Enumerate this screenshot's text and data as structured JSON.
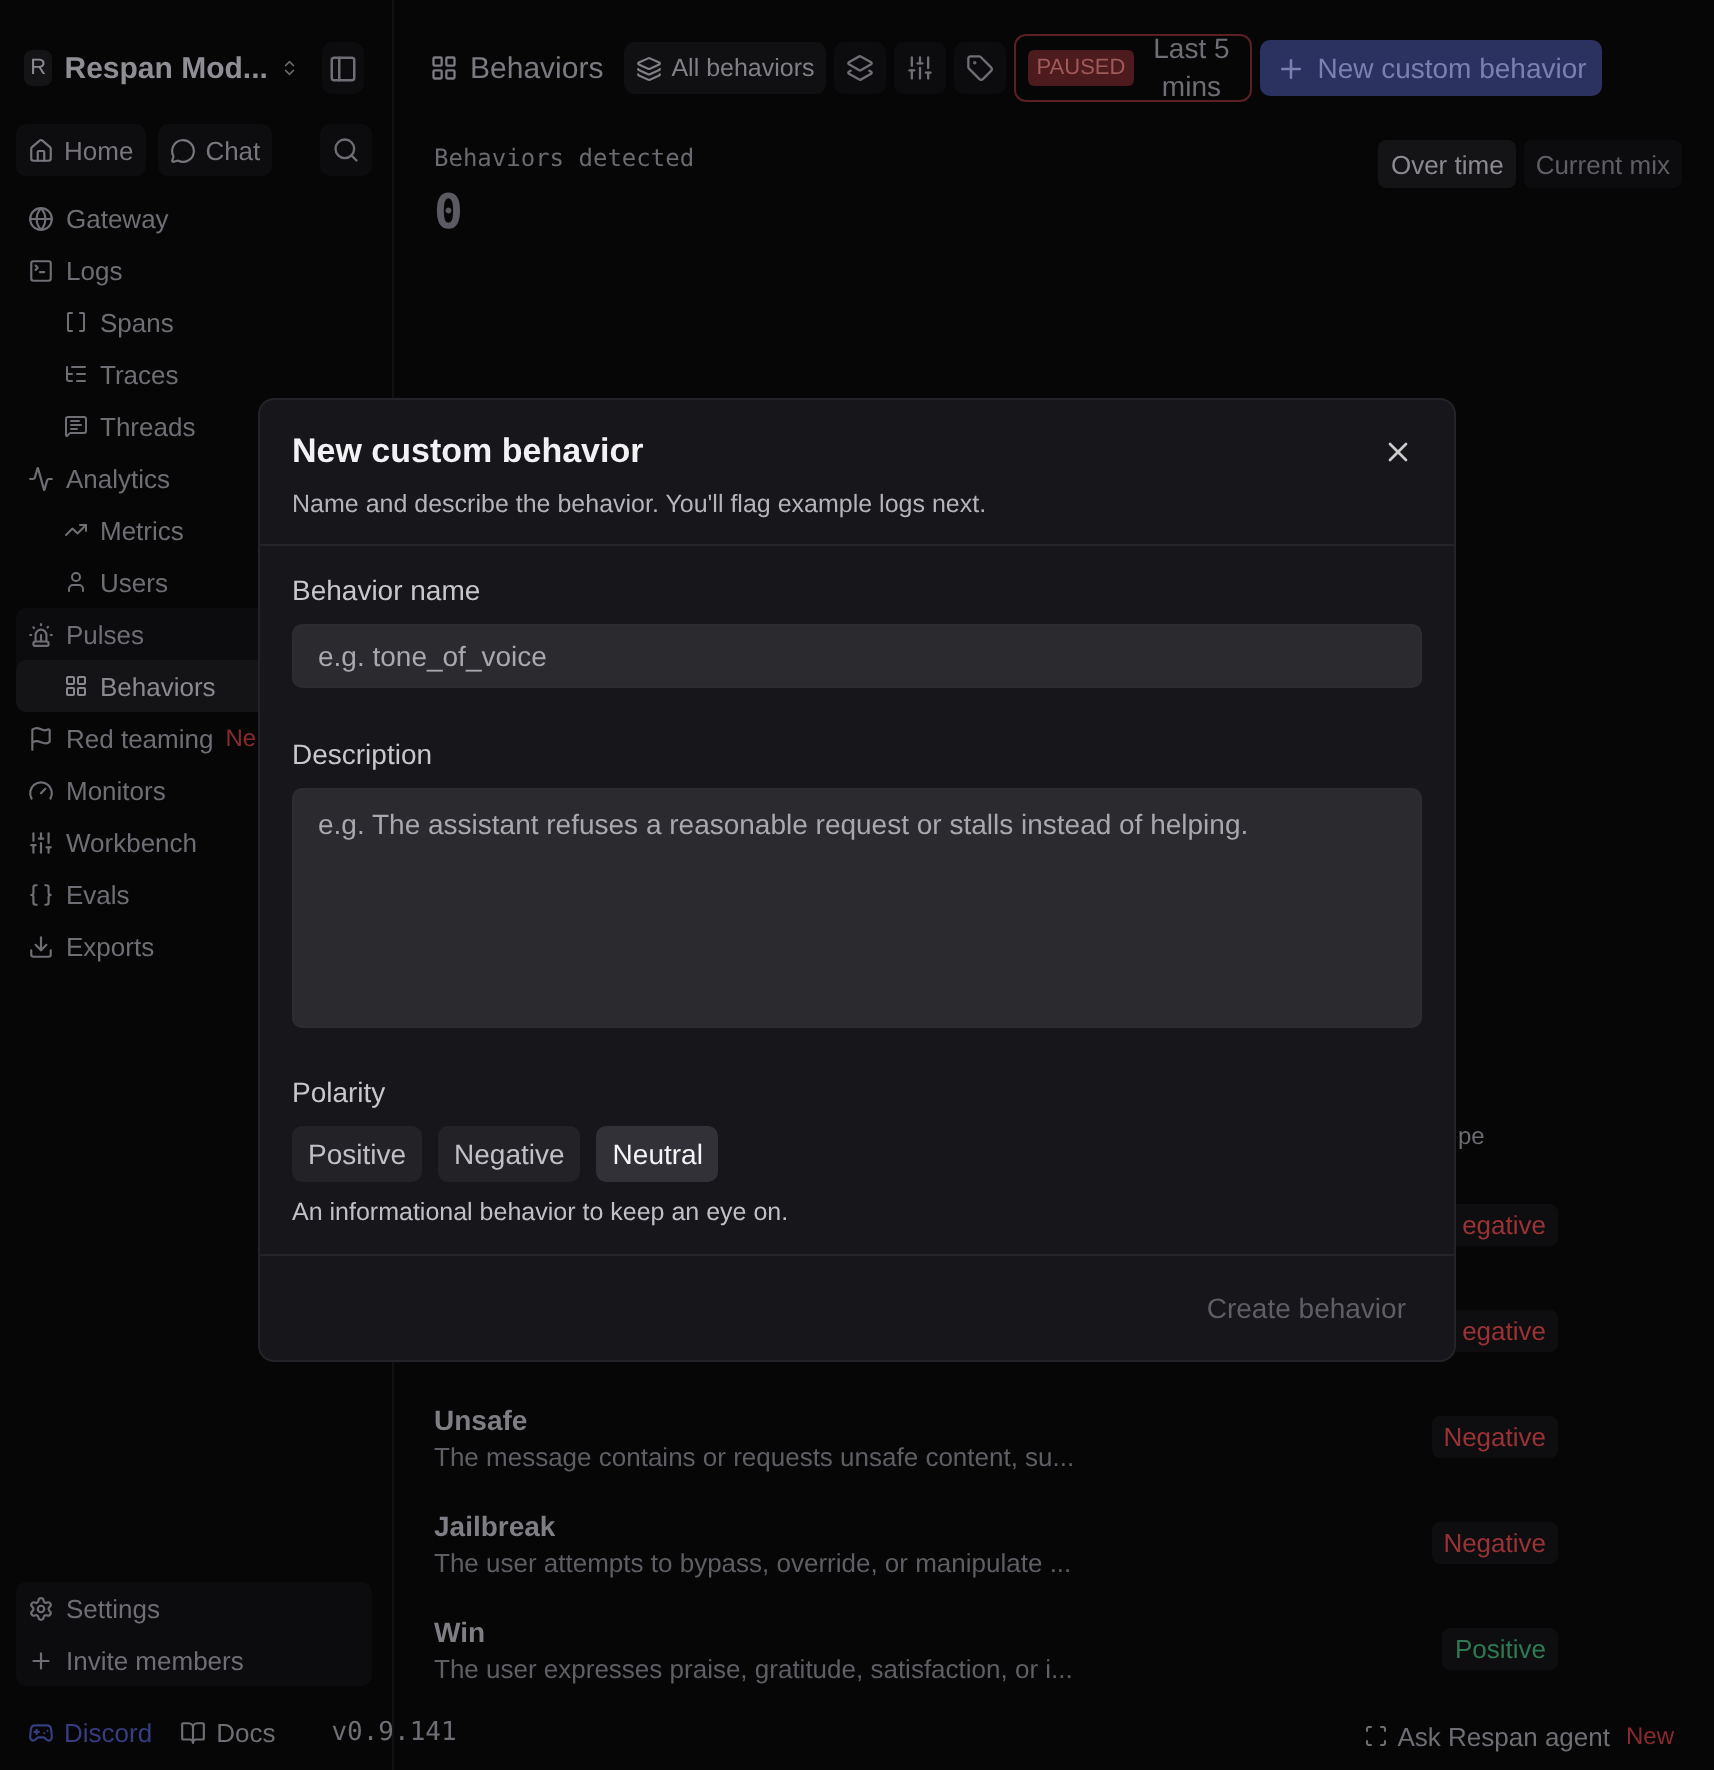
{
  "sidebar": {
    "workspace": {
      "initial": "R",
      "name": "Respan Mod..."
    },
    "quick": [
      {
        "label": "Home"
      },
      {
        "label": "Chat"
      }
    ],
    "nav": [
      {
        "label": "Gateway"
      },
      {
        "label": "Logs",
        "children": [
          {
            "label": "Spans",
            "selected": false
          },
          {
            "label": "Traces",
            "selected": false
          },
          {
            "label": "Threads",
            "selected": false
          }
        ]
      },
      {
        "label": "Analytics",
        "children": [
          {
            "label": "Metrics",
            "selected": false
          },
          {
            "label": "Users",
            "selected": false
          }
        ]
      },
      {
        "label": "Pulses",
        "children": [
          {
            "label": "Behaviors",
            "selected": true
          }
        ]
      },
      {
        "label": "Red teaming",
        "badge": "Ne"
      },
      {
        "label": "Monitors"
      },
      {
        "label": "Workbench"
      },
      {
        "label": "Evals"
      },
      {
        "label": "Exports"
      }
    ],
    "bottom": [
      {
        "label": "Settings"
      },
      {
        "label": "Invite members"
      }
    ],
    "footer": {
      "discord": "Discord",
      "docs": "Docs",
      "version": "v0.9.141"
    }
  },
  "toolbar": {
    "title": "Behaviors",
    "filter": "All behaviors",
    "status": "PAUSED",
    "range": "Last 5 mins",
    "primary": "New custom behavior"
  },
  "summary": {
    "label": "Behaviors detected",
    "value": "0",
    "views": [
      {
        "label": "Over time",
        "selected": true
      },
      {
        "label": "Current mix",
        "selected": false
      }
    ]
  },
  "table": {
    "columns": [
      "pe"
    ],
    "rows": [
      {
        "type": "egative",
        "color": "#9b3236"
      },
      {
        "type": "egative",
        "color": "#9b3236"
      },
      {
        "name": "Unsafe",
        "description": "The message contains or requests unsafe content, su...",
        "type": "Negative",
        "color": "#9b3236"
      },
      {
        "name": "Jailbreak",
        "description": "The user attempts to bypass, override, or manipulate ...",
        "type": "Negative",
        "color": "#9b3236"
      },
      {
        "name": "Win",
        "description": "The user expresses praise, gratitude, satisfaction, or i...",
        "type": "Positive",
        "color": "#2f7a52"
      }
    ]
  },
  "agent": {
    "label": "Ask Respan agent",
    "badge": "New"
  },
  "dialog": {
    "title": "New custom behavior",
    "subtitle": "Name and describe the behavior. You'll flag example logs next.",
    "name_label": "Behavior name",
    "name_placeholder": "e.g. tone_of_voice",
    "description_label": "Description",
    "description_placeholder": "e.g. The assistant refuses a reasonable request or stalls instead of helping.",
    "polarity_label": "Polarity",
    "polarity": [
      {
        "label": "Positive",
        "selected": false
      },
      {
        "label": "Negative",
        "selected": false
      },
      {
        "label": "Neutral",
        "selected": true
      }
    ],
    "polarity_hint": "An informational behavior to keep an eye on.",
    "submit": {
      "label": "Create behavior",
      "disabled": true
    }
  }
}
